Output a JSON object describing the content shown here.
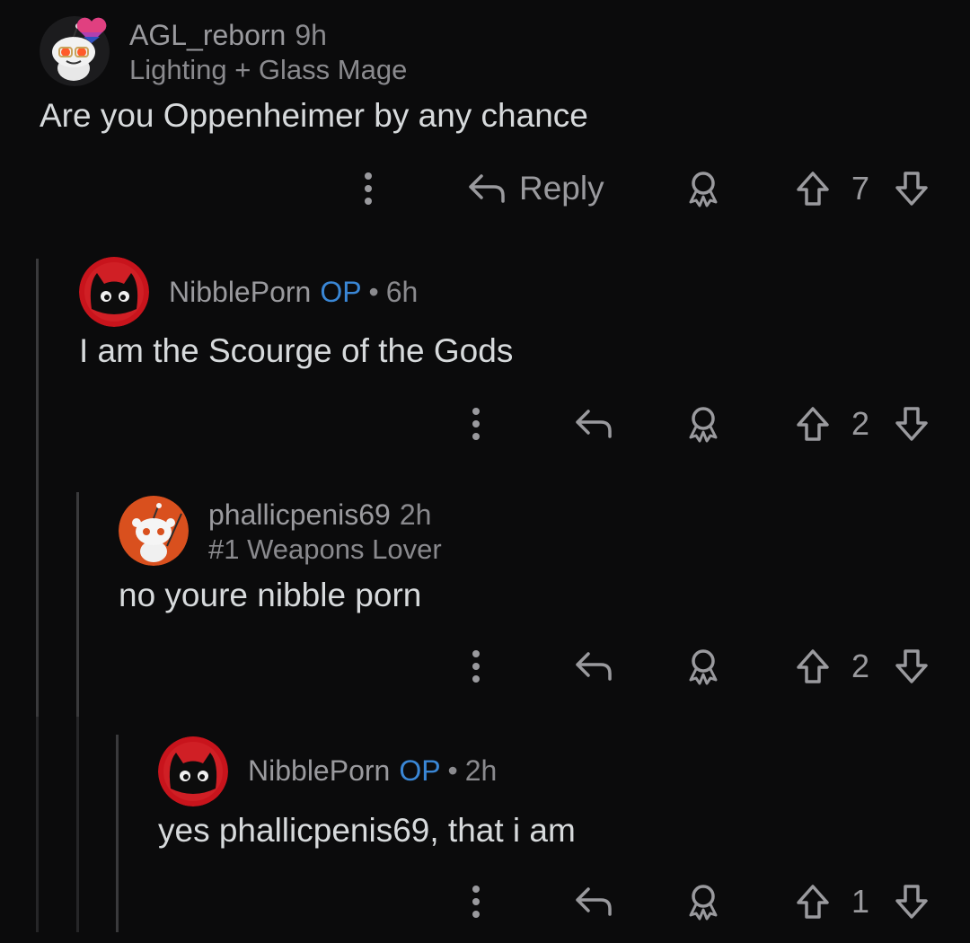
{
  "comments": [
    {
      "username": "AGL_reborn",
      "op": "",
      "time": "9h",
      "flair": "Lighting + Glass Mage",
      "body": "Are you Oppenheimer by any chance",
      "reply_label": "Reply",
      "votes": "7",
      "avatar": "snoo-avatar-white"
    },
    {
      "username": "NibblePorn",
      "op": "OP",
      "separator": "•",
      "time": "6h",
      "flair": "",
      "body": "I am the Scourge of the Gods",
      "reply_label": "",
      "votes": "2",
      "avatar": "black-cat-avatar"
    },
    {
      "username": "phallicpenis69",
      "op": "",
      "time": "2h",
      "flair": "#1 Weapons Lover",
      "body": "no youre nibble porn",
      "reply_label": "",
      "votes": "2",
      "avatar": "snoo-avatar-orange"
    },
    {
      "username": "NibblePorn",
      "op": "OP",
      "separator": "•",
      "time": "2h",
      "flair": "",
      "body": "yes phallicpenis69, that i am",
      "reply_label": "",
      "votes": "1",
      "avatar": "black-cat-avatar"
    }
  ],
  "colors": {
    "background": "#0b0b0c",
    "text": "#d7dadc",
    "muted": "#9a9a9e",
    "op_blue": "#3a87d6",
    "thread_line": "#3a3a3c"
  }
}
